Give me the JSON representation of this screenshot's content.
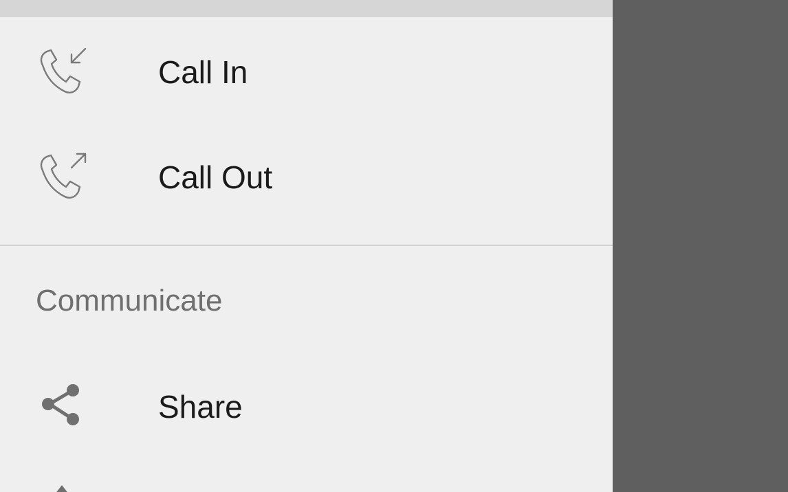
{
  "drawer": {
    "background": "#efefef",
    "top_band_color": "#d6d6d6",
    "items": [
      {
        "label": "Call In",
        "icon": "call-in-icon"
      },
      {
        "label": "Call Out",
        "icon": "call-out-icon"
      }
    ],
    "sections": [
      {
        "header": "Communicate",
        "items": [
          {
            "label": "Share",
            "icon": "share-icon"
          }
        ]
      }
    ]
  },
  "scrim": {
    "color": "#5f5f5f"
  }
}
